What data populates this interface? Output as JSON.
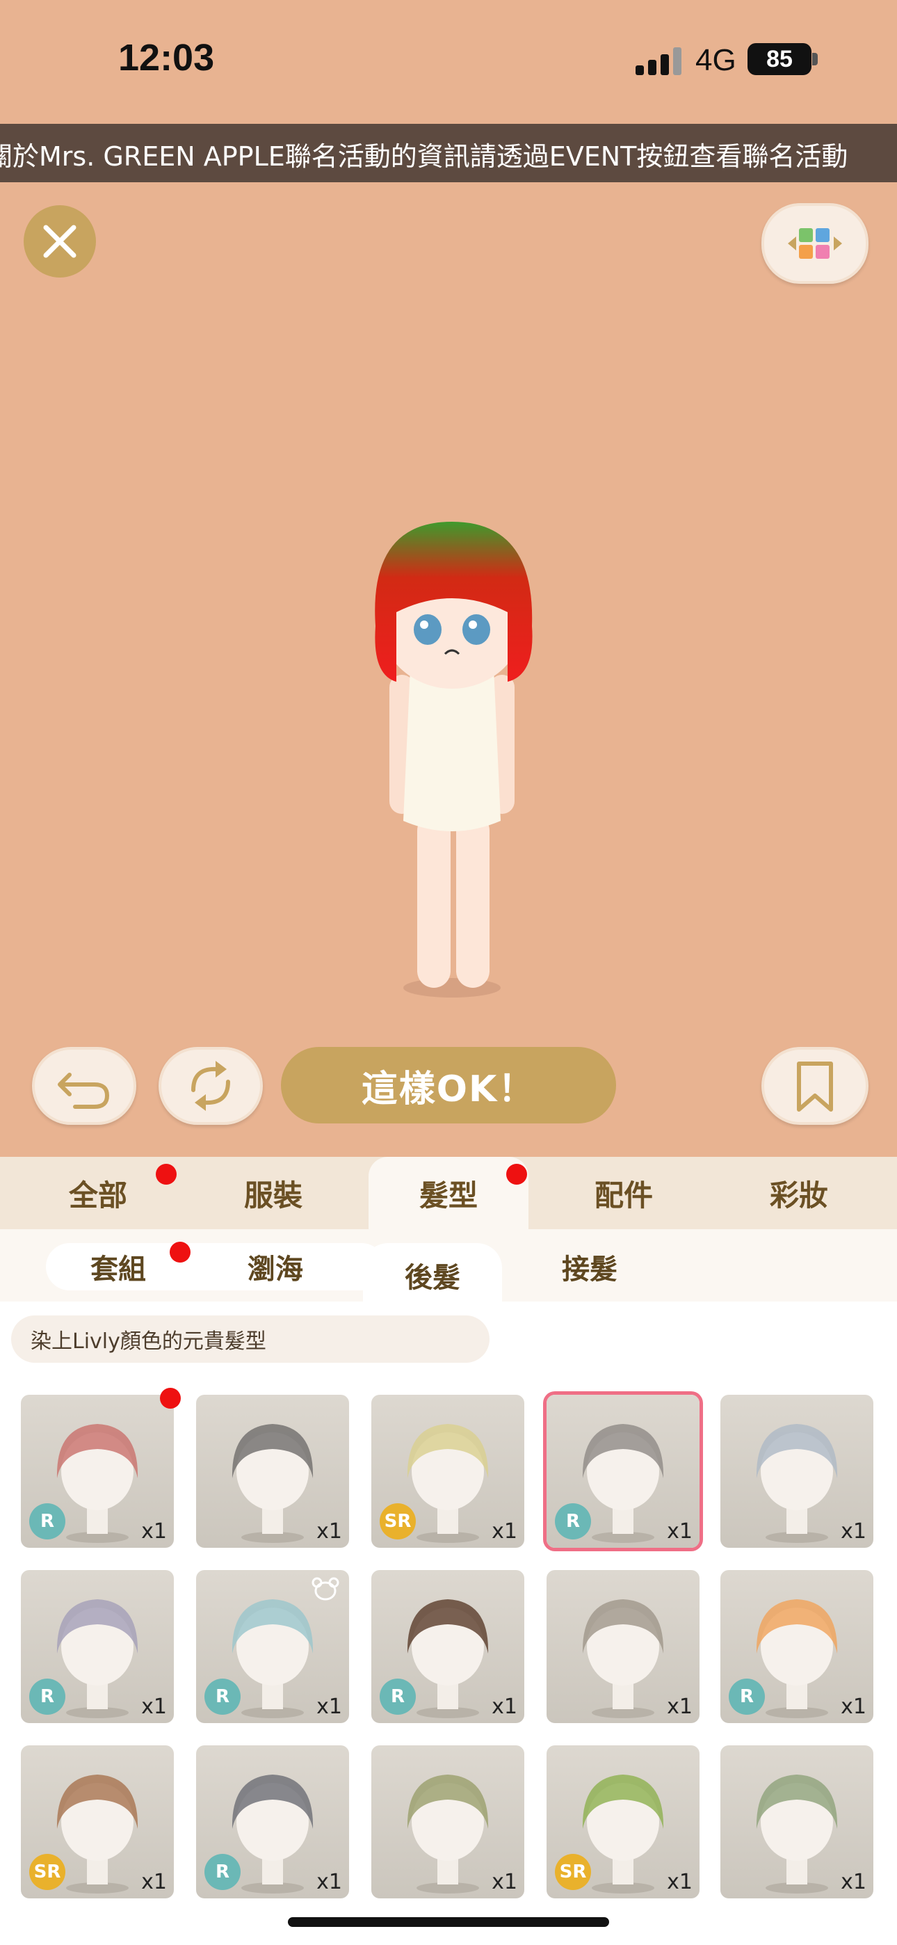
{
  "status_bar": {
    "time": "12:03",
    "network": "4G",
    "battery": "85"
  },
  "announcement": "關於Mrs. GREEN APPLE聯名活動的資訊請透過EVENT按鈕查看聯名活動",
  "actions": {
    "ok_label": "這樣OK！"
  },
  "category_tabs": [
    {
      "label": "全部",
      "badge": true
    },
    {
      "label": "服裝",
      "badge": false
    },
    {
      "label": "髮型",
      "badge": true,
      "active": true
    },
    {
      "label": "配件",
      "badge": false
    },
    {
      "label": "彩妝",
      "badge": false
    }
  ],
  "sub_tabs": [
    {
      "label": "套組",
      "badge": true
    },
    {
      "label": "瀏海"
    },
    {
      "label": "後髮",
      "active": true
    },
    {
      "label": "接髮"
    }
  ],
  "description": "染上Livly顏色的元貴髮型",
  "items": [
    {
      "rarity": "R",
      "qty": "x1",
      "hair_color": "#c9706b",
      "new": true
    },
    {
      "rarity": "",
      "qty": "x1",
      "hair_color": "#6f6d6b"
    },
    {
      "rarity": "SR",
      "qty": "x1",
      "hair_color": "#d9cf8e"
    },
    {
      "rarity": "R",
      "qty": "x1",
      "hair_color": "#8f8a86",
      "selected": true
    },
    {
      "rarity": "",
      "qty": "x1",
      "hair_color": "#aeb9c5"
    },
    {
      "rarity": "R",
      "qty": "x1",
      "hair_color": "#a49fb8"
    },
    {
      "rarity": "R",
      "qty": "x1",
      "hair_color": "#9ac6cc",
      "bear": true
    },
    {
      "rarity": "R",
      "qty": "x1",
      "hair_color": "#5a3c2a"
    },
    {
      "rarity": "",
      "qty": "x1",
      "hair_color": "#9f968a"
    },
    {
      "rarity": "R",
      "qty": "x1",
      "hair_color": "#f0a25a"
    },
    {
      "rarity": "SR",
      "qty": "x1",
      "hair_color": "#a8734f"
    },
    {
      "rarity": "R",
      "qty": "x1",
      "hair_color": "#6b6d74"
    },
    {
      "rarity": "",
      "qty": "x1",
      "hair_color": "#9a9f6c"
    },
    {
      "rarity": "SR",
      "qty": "x1",
      "hair_color": "#8db04f"
    },
    {
      "rarity": "",
      "qty": "x1",
      "hair_color": "#8ea27a"
    }
  ]
}
